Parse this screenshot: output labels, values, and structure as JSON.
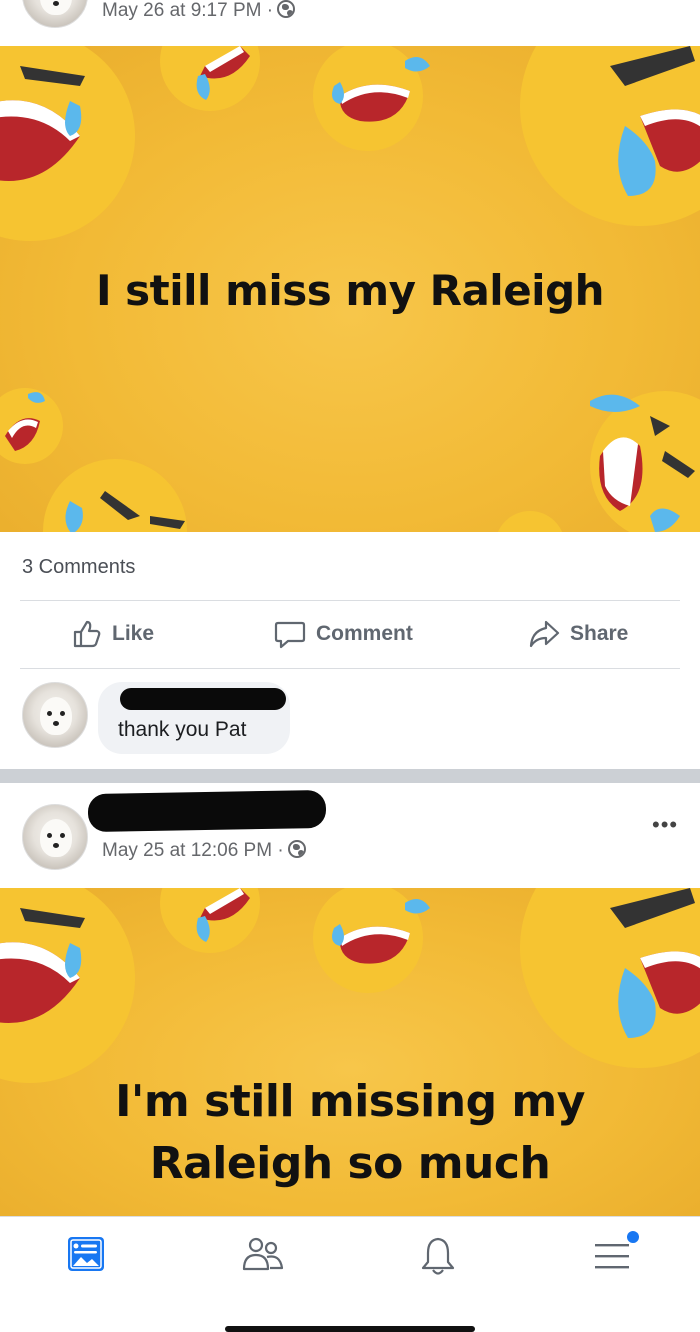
{
  "post1": {
    "timestamp": "May 26 at 9:17 PM ·",
    "image_text": "I still miss my Raleigh",
    "comment_count": "3 Comments"
  },
  "actions": {
    "like": "Like",
    "comment": "Comment",
    "share": "Share"
  },
  "comment": {
    "author": "[redacted]",
    "text": "thank you Pat"
  },
  "post2": {
    "author": "[redacted]",
    "timestamp": "May 25 at 12:06 PM ·",
    "image_text_line1": "I'm still missing my",
    "image_text_line2": "Raleigh so much",
    "more_label": "•••"
  },
  "tabbar": {
    "icons": [
      "news-feed-icon",
      "friends-icon",
      "notifications-icon",
      "menu-icon"
    ],
    "notification_dot_color": "#1877f2"
  },
  "colors": {
    "image_background": "#f2ba36",
    "emoji_face": "#f6c431",
    "tear": "#5bb8ec",
    "mouth": "#b8262b",
    "action_text": "#606770",
    "accent": "#1877f2"
  }
}
